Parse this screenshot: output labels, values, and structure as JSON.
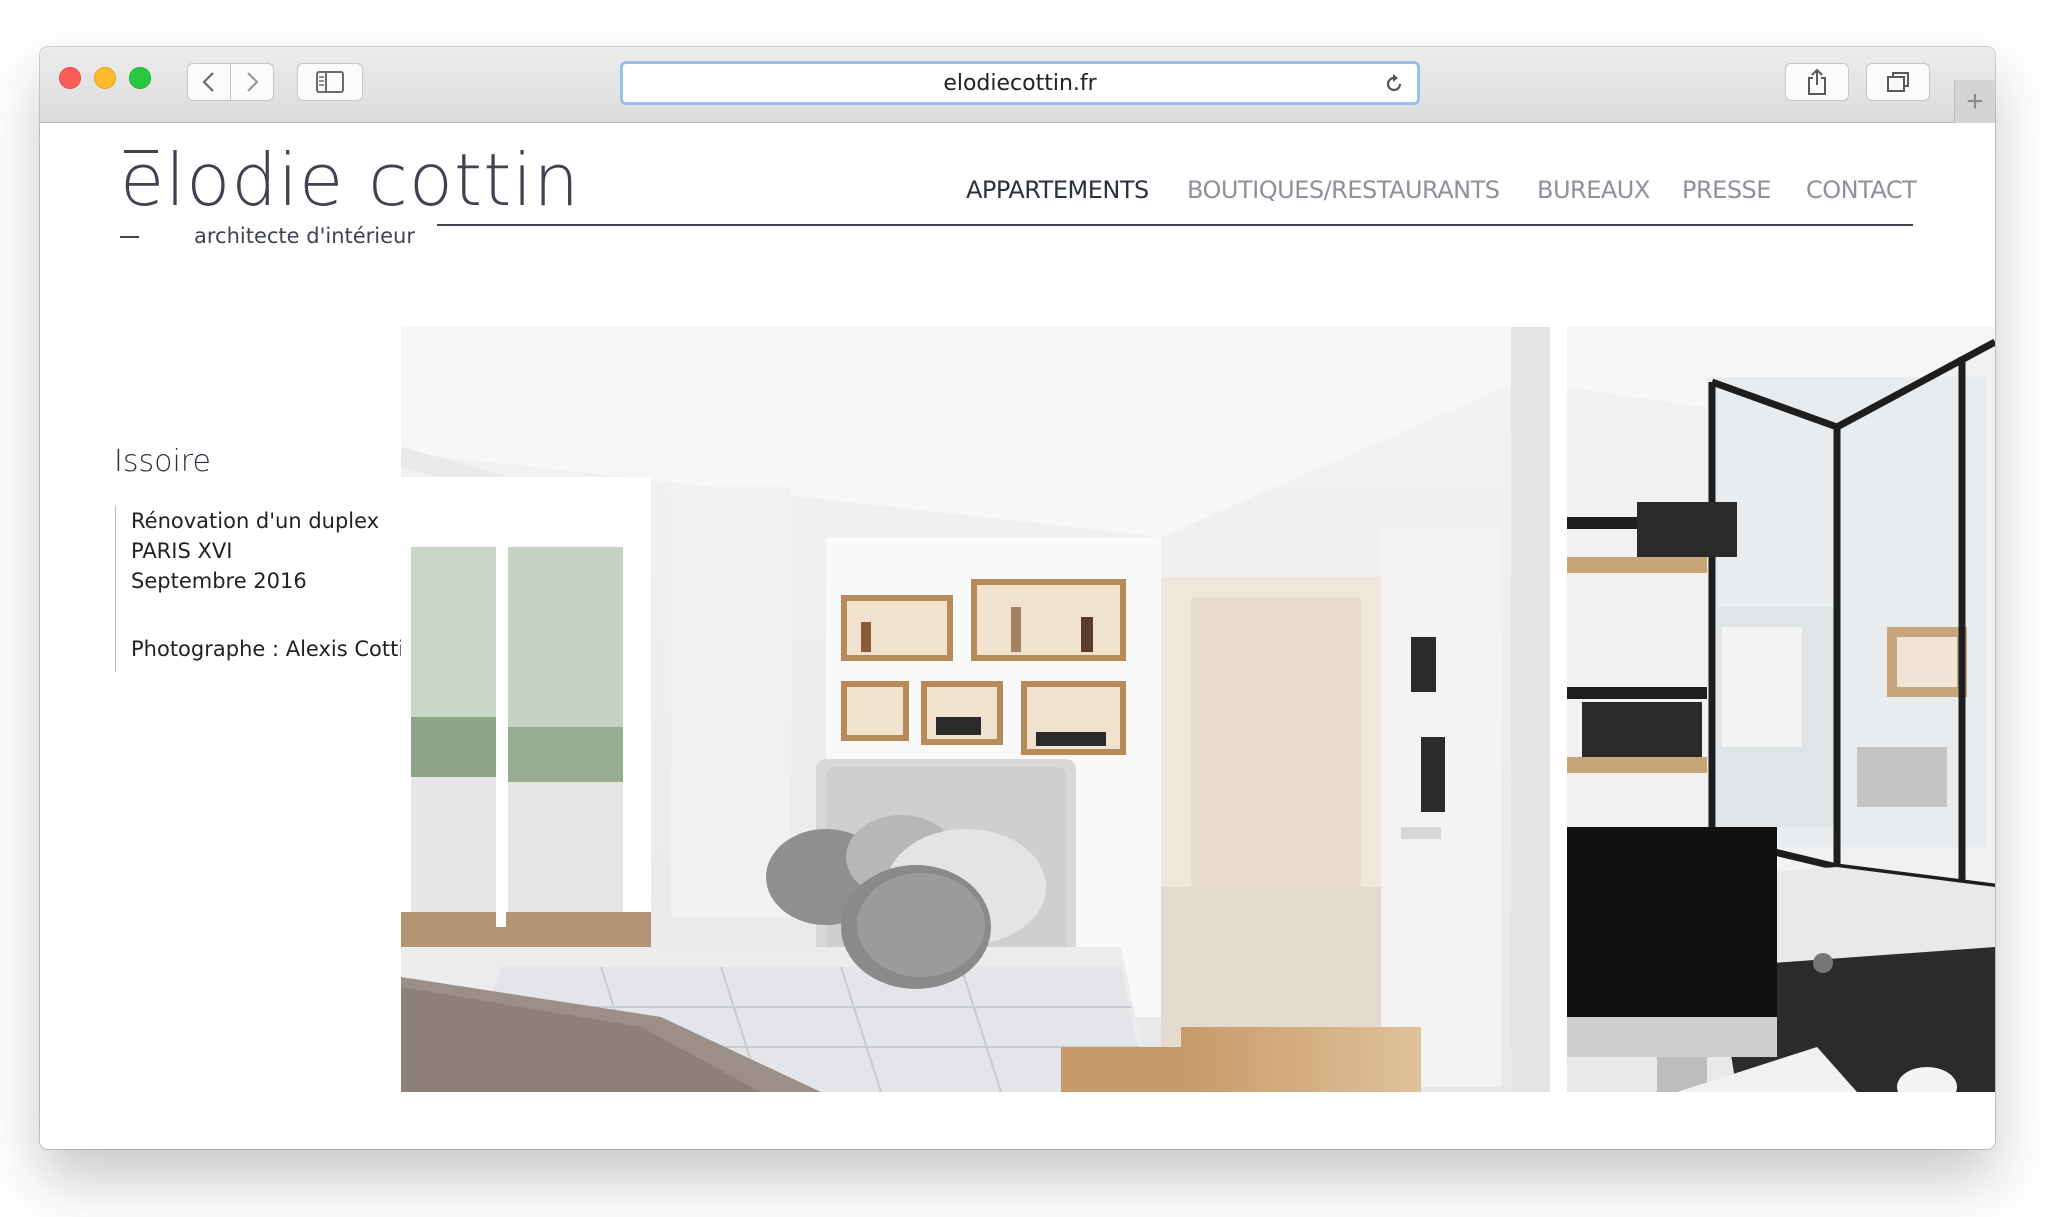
{
  "browser": {
    "url": "elodiecottin.fr",
    "newtab_label": "+"
  },
  "logo": {
    "name": "elodie cottin",
    "tagline": "architecte d'intérieur"
  },
  "nav": {
    "items": [
      {
        "label": "APPARTEMENTS",
        "active": true
      },
      {
        "label": "BOUTIQUES/RESTAURANTS",
        "active": false
      },
      {
        "label": "BUREAUX",
        "active": false
      },
      {
        "label": "PRESSE",
        "active": false
      },
      {
        "label": "CONTACT",
        "active": false
      }
    ]
  },
  "project": {
    "title": "Issoire",
    "description": "Rénovation d'un duplex",
    "location": "PARIS XVI",
    "date": "Septembre 2016",
    "photographer": "Photographe : Alexis Cottin"
  },
  "colors": {
    "text_dark": "#2c3140",
    "nav_inactive": "#8e9199",
    "rule": "#3f4350"
  },
  "icons": {
    "back": "chevron-left-icon",
    "forward": "chevron-right-icon",
    "sidebar": "sidebar-icon",
    "reload": "reload-icon",
    "share": "share-icon",
    "tabs": "tabs-icon"
  }
}
